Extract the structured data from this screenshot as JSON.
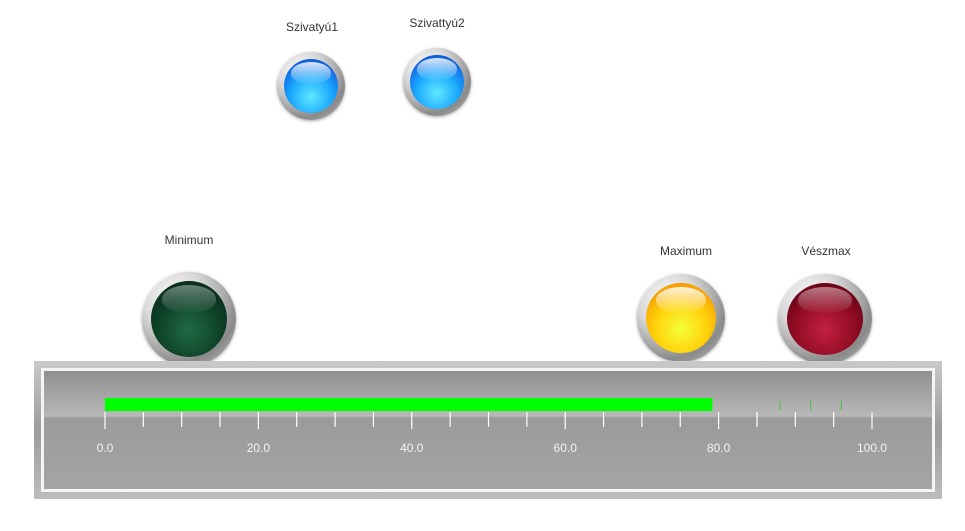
{
  "lamps": {
    "pump1": {
      "label": "Szivatyú1",
      "color": "#1aa8ff"
    },
    "pump2": {
      "label": "Szivattyú2",
      "color": "#1aa8ff"
    },
    "minimum": {
      "label": "Minimum",
      "color": "#0d3e26"
    },
    "maximum": {
      "label": "Maximum",
      "color": "#ffd20a"
    },
    "emergency_max": {
      "label": "Vészmax",
      "color": "#8a0a20"
    }
  },
  "level_gauge": {
    "min": 0,
    "max": 100,
    "value": 79.2,
    "bar_color": "#00ff00",
    "tick_labels": [
      "0.0",
      "20.0",
      "40.0",
      "60.0",
      "80.0",
      "100.0"
    ],
    "major_step": 20,
    "minor_step": 5,
    "markers": [
      88,
      92,
      96
    ]
  }
}
